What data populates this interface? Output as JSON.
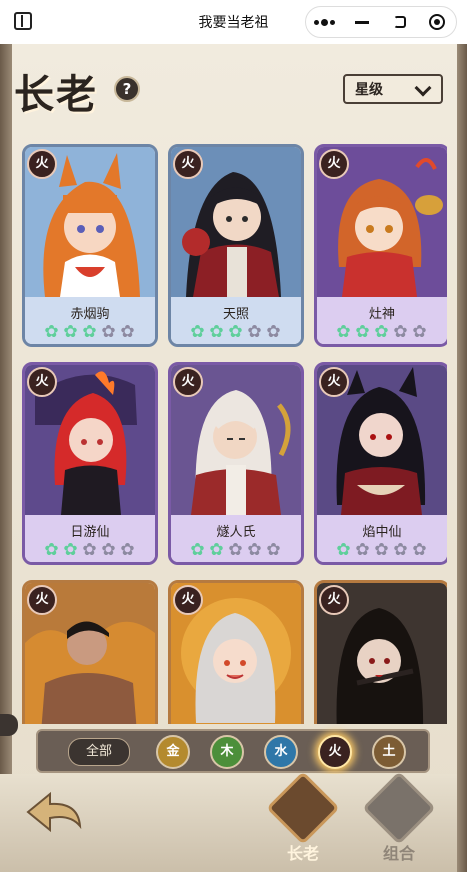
{
  "window": {
    "title": "我要当老祖"
  },
  "header": {
    "title": "长老",
    "sort_label": "星级"
  },
  "cards": [
    {
      "name": "赤烟驹",
      "element": "火",
      "stars_filled": 2.5,
      "stars_total": 5
    },
    {
      "name": "天照",
      "element": "火",
      "stars_filled": 2.5,
      "stars_total": 5
    },
    {
      "name": "灶神",
      "element": "火",
      "stars_filled": 2.5,
      "stars_total": 5
    },
    {
      "name": "日游仙",
      "element": "火",
      "stars_filled": 2,
      "stars_total": 5
    },
    {
      "name": "燧人氏",
      "element": "火",
      "stars_filled": 1.5,
      "stars_total": 5
    },
    {
      "name": "焰中仙",
      "element": "火",
      "stars_filled": 1,
      "stars_total": 5
    },
    {
      "name": "",
      "element": "火"
    },
    {
      "name": "",
      "element": "火"
    },
    {
      "name": "",
      "element": "火"
    }
  ],
  "filters": {
    "all_label": "全部",
    "elements": [
      "金",
      "木",
      "水",
      "火",
      "土"
    ],
    "selected": "火"
  },
  "nav": {
    "tabs": [
      "长老",
      "组合"
    ],
    "active": "长老"
  },
  "colors": {
    "fire": "#c0392b",
    "metal": "#c59a3a",
    "wood": "#4f9a3a",
    "water": "#2f7fb3",
    "earth": "#8a6a3a"
  }
}
